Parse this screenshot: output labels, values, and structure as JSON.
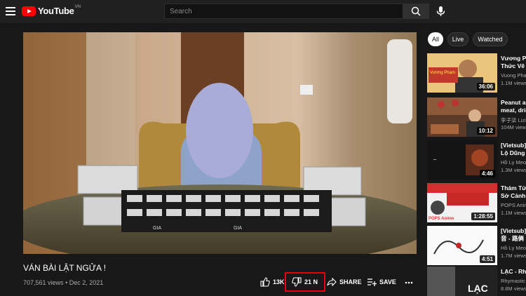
{
  "header": {
    "logo_text": "YouTube",
    "country_code": "VN",
    "search_placeholder": "Search"
  },
  "video": {
    "title": "VÁN BÀI LẬT NGỬA !",
    "views": "707,561 views",
    "date": "Dec 2, 2021",
    "likes": "13K",
    "dislikes": "21 N",
    "share_label": "SHARE",
    "save_label": "SAVE",
    "case_label": "GIA"
  },
  "chips": [
    "All",
    "Live",
    "Watched"
  ],
  "recommendations": [
    {
      "title": "Vương Ph",
      "subtitle": "Thức Vẽ C",
      "channel": "Vuong Pha",
      "stats": "1.1M views",
      "duration": "36:06",
      "thumb_text": "Vương Phạm"
    },
    {
      "title": "Peanut ar",
      "subtitle": "meat, drie",
      "channel": "李子柒 Lizi",
      "stats": "104M views",
      "duration": "10:12"
    },
    {
      "title": "[Vietsub]",
      "subtitle": "Lộ Dũng |",
      "channel": "Hồ Ly Meo",
      "stats": "1.3M views",
      "duration": "4:46"
    },
    {
      "title": "Thám Tử",
      "subtitle": "Sở Cảnh S",
      "channel": "POPS Anim",
      "stats": "1.1M views",
      "duration": "1:28:55",
      "thumb_text": "POPS Anime"
    },
    {
      "title": "[Vietsub]",
      "subtitle": "音 - 路俩",
      "channel": "Hồ Ly Meo",
      "stats": "1.7M views",
      "duration": "4:51"
    },
    {
      "title": "LẠC - Rhy",
      "subtitle": "",
      "channel": "Rhymastic",
      "stats": "8.8M views",
      "duration": "",
      "thumb_text": "LẠC"
    }
  ]
}
